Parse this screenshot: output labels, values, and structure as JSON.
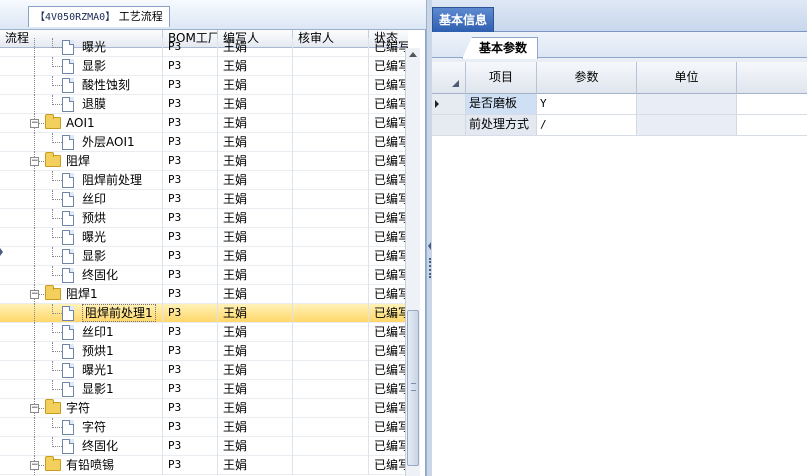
{
  "left_tab": {
    "code": "【4V050RZMA0】",
    "title": "工艺流程"
  },
  "grid_headers": {
    "process": "流程",
    "bom": "BOM工厂",
    "writer": "编写人",
    "reviewer": "核审人",
    "status": "状态"
  },
  "rows": [
    {
      "name": "曝光",
      "level": 2,
      "kind": "doc",
      "bom": "P3",
      "writer": "王娟",
      "reviewer": "",
      "status": "已编写"
    },
    {
      "name": "显影",
      "level": 2,
      "kind": "doc",
      "bom": "P3",
      "writer": "王娟",
      "reviewer": "",
      "status": "已编写"
    },
    {
      "name": "酸性蚀刻",
      "level": 2,
      "kind": "doc",
      "bom": "P3",
      "writer": "王娟",
      "reviewer": "",
      "status": "已编写"
    },
    {
      "name": "退膜",
      "level": 2,
      "kind": "doc",
      "bom": "P3",
      "writer": "王娟",
      "reviewer": "",
      "status": "已编写"
    },
    {
      "name": "AOI1",
      "level": 1,
      "kind": "folder",
      "bom": "P3",
      "writer": "王娟",
      "reviewer": "",
      "status": "已编写"
    },
    {
      "name": "外层AOI1",
      "level": 2,
      "kind": "doc",
      "bom": "P3",
      "writer": "王娟",
      "reviewer": "",
      "status": "已编写"
    },
    {
      "name": "阻焊",
      "level": 1,
      "kind": "folder",
      "bom": "P3",
      "writer": "王娟",
      "reviewer": "",
      "status": "已编写"
    },
    {
      "name": "阻焊前处理",
      "level": 2,
      "kind": "doc",
      "bom": "P3",
      "writer": "王娟",
      "reviewer": "",
      "status": "已编写"
    },
    {
      "name": "丝印",
      "level": 2,
      "kind": "doc",
      "bom": "P3",
      "writer": "王娟",
      "reviewer": "",
      "status": "已编写"
    },
    {
      "name": "预烘",
      "level": 2,
      "kind": "doc",
      "bom": "P3",
      "writer": "王娟",
      "reviewer": "",
      "status": "已编写"
    },
    {
      "name": "曝光",
      "level": 2,
      "kind": "doc",
      "bom": "P3",
      "writer": "王娟",
      "reviewer": "",
      "status": "已编写"
    },
    {
      "name": "显影",
      "level": 2,
      "kind": "doc",
      "bom": "P3",
      "writer": "王娟",
      "reviewer": "",
      "status": "已编写"
    },
    {
      "name": "终固化",
      "level": 2,
      "kind": "doc",
      "bom": "P3",
      "writer": "王娟",
      "reviewer": "",
      "status": "已编写"
    },
    {
      "name": "阻焊1",
      "level": 1,
      "kind": "folder",
      "bom": "P3",
      "writer": "王娟",
      "reviewer": "",
      "status": "已编写"
    },
    {
      "name": "阻焊前处理1",
      "level": 2,
      "kind": "doc",
      "bom": "P3",
      "writer": "王娟",
      "reviewer": "",
      "status": "已编写",
      "selected": true
    },
    {
      "name": "丝印1",
      "level": 2,
      "kind": "doc",
      "bom": "P3",
      "writer": "王娟",
      "reviewer": "",
      "status": "已编写"
    },
    {
      "name": "预烘1",
      "level": 2,
      "kind": "doc",
      "bom": "P3",
      "writer": "王娟",
      "reviewer": "",
      "status": "已编写"
    },
    {
      "name": "曝光1",
      "level": 2,
      "kind": "doc",
      "bom": "P3",
      "writer": "王娟",
      "reviewer": "",
      "status": "已编写"
    },
    {
      "name": "显影1",
      "level": 2,
      "kind": "doc",
      "bom": "P3",
      "writer": "王娟",
      "reviewer": "",
      "status": "已编写"
    },
    {
      "name": "字符",
      "level": 1,
      "kind": "folder",
      "bom": "P3",
      "writer": "王娟",
      "reviewer": "",
      "status": "已编写"
    },
    {
      "name": "字符",
      "level": 2,
      "kind": "doc",
      "bom": "P3",
      "writer": "王娟",
      "reviewer": "",
      "status": "已编写"
    },
    {
      "name": "终固化",
      "level": 2,
      "kind": "doc",
      "bom": "P3",
      "writer": "王娟",
      "reviewer": "",
      "status": "已编写"
    },
    {
      "name": "有铅喷锡",
      "level": 1,
      "kind": "folder",
      "bom": "P3",
      "writer": "王娟",
      "reviewer": "",
      "status": "已编写"
    }
  ],
  "right": {
    "tab": "基本信息",
    "subtab": "基本参数",
    "param_headers": {
      "item": "项目",
      "param": "参数",
      "unit": "单位"
    },
    "params": [
      {
        "item": "是否磨板",
        "value": "Y",
        "unit": "",
        "current": true
      },
      {
        "item": "前处理方式",
        "value": "/",
        "unit": "",
        "current": false
      }
    ]
  },
  "colors": {
    "selected_row": "#ffd76a",
    "tab_active": "#2e5fb0"
  }
}
